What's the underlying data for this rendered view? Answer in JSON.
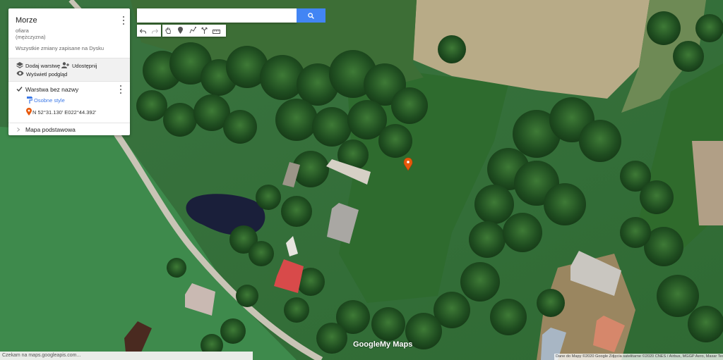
{
  "map_title": "Morze",
  "description_line1": "ofiara",
  "description_line2": "(mężczyzna)",
  "save_status": "Wszystkie zmiany zapisane na Dysku",
  "actions": {
    "add_layer": "Dodaj warstwę",
    "share": "Udostępnij",
    "preview": "Wyświetl podgląd"
  },
  "layer": {
    "name": "Warstwa bez nazwy",
    "style_link": "Osobne style",
    "placemark": "N 52°31.130' E022°44.392'"
  },
  "basemap": {
    "label": "Mapa podstawowa"
  },
  "search": {
    "value": "",
    "placeholder": ""
  },
  "toolbar_icons": [
    "undo-icon",
    "redo-icon",
    "hand-icon",
    "marker-icon",
    "draw-line-icon",
    "directions-icon",
    "ruler-icon"
  ],
  "status_bar": "Czekam na maps.googleapis.com...",
  "attribution": "Dane do Mapy ©2020 Google Zdjęcia satelitarne ©2020 CNES / Airbus, MGGP Aero, Maxar Tec",
  "logo_text": {
    "part1": "Google",
    "part2": "My Maps"
  },
  "colors": {
    "accent_blue": "#4285f4",
    "link_blue": "#3b78e7",
    "marker_orange": "#e8590c",
    "field_green": "#3f7a3a",
    "crop_beige": "#b8ab87",
    "road_gray": "#c9c4b6"
  }
}
